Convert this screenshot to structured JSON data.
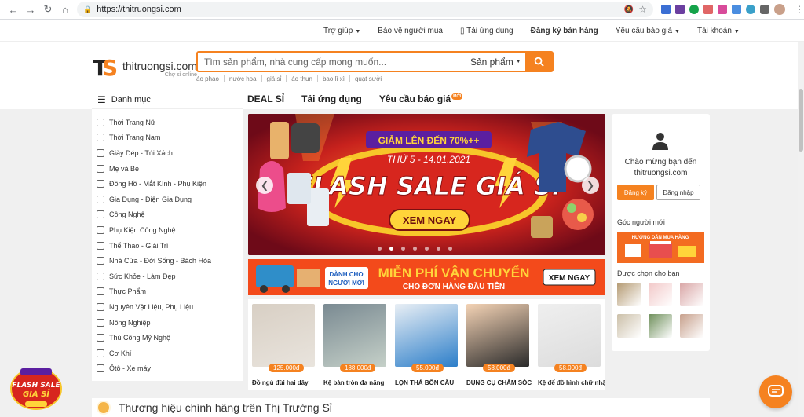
{
  "browser": {
    "url": "https://thitruongsi.com"
  },
  "topbar": {
    "items": [
      "Trợ giúp",
      "Bảo vệ người mua",
      "Tải ứng dụng",
      "Đăng ký bán hàng",
      "Yêu cầu báo giá",
      "Tài khoản"
    ]
  },
  "logo": {
    "name": "thitruongsi.com",
    "sub": "Chợ sỉ online"
  },
  "search": {
    "placeholder": "Tìm sản phẩm, nhà cung cấp mong muốn...",
    "category": "Sản phẩm",
    "hints": [
      "áo phao",
      "nước hoa",
      "giá sỉ",
      "áo thun",
      "bao lì xì",
      "quạt sưởi"
    ]
  },
  "sidebar": {
    "title": "Danh mục",
    "items": [
      "Thời Trang Nữ",
      "Thời Trang Nam",
      "Giày Dép - Túi Xách",
      "Mẹ và Bé",
      "Đồng Hồ - Mắt Kính - Phụ Kiện",
      "Gia Dụng - Điện Gia Dụng",
      "Công Nghệ",
      "Phụ Kiện Công Nghệ",
      "Thể Thao - Giải Trí",
      "Nhà Cửa - Đời Sống - Bách Hóa",
      "Sức Khỏe - Làm Đẹp",
      "Thực Phẩm",
      "Nguyên Vật Liệu, Phụ Liệu",
      "Nông Nghiệp",
      "Thủ Công Mỹ Nghệ",
      "Cơ Khí",
      "Ôtô - Xe máy"
    ]
  },
  "tabs": {
    "deal": "DEAL SỈ",
    "app": "Tải ứng dụng",
    "quote": "Yêu cầu báo giá",
    "badge": "MỚI"
  },
  "banner": {
    "discount": "GIẢM LÊN ĐẾN 70%++",
    "date": "THỨ 5 - 14.01.2021",
    "title": "FLASH SALE GIÁ SỈ",
    "cta": "XEM NGAY",
    "dot_count": 7,
    "active_dot": 1
  },
  "ship_banner": {
    "tag_line1": "DÀNH CHO",
    "tag_line2": "NGƯỜI MỚI",
    "title": "MIỄN PHÍ VẬN CHUYỂN",
    "subtitle": "CHO ĐƠN HÀNG ĐẦU TIÊN",
    "cta": "XEM NGAY"
  },
  "products": [
    {
      "price": "125.000đ",
      "name": "Đồ ngủ đùi hai dây",
      "colors": [
        "#d8cfc4",
        "#e9e4dd"
      ]
    },
    {
      "price": "188.000đ",
      "name": "Kệ bàn tròn đa năng",
      "colors": [
        "#7a8a92",
        "#c5d0c8"
      ]
    },
    {
      "price": "55.000đ",
      "name": "LỌN THẢ BỒN CẦU",
      "colors": [
        "#e9eff5",
        "#2c7ec9"
      ]
    },
    {
      "price": "58.000đ",
      "name": "DỤNG CỤ CHĂM SÓC",
      "colors": [
        "#f4d3b5",
        "#2a2a2a"
      ]
    },
    {
      "price": "58.000đ",
      "name": "Kệ để đồ hình chữ nhật",
      "colors": [
        "#efefef",
        "#dcdcdc"
      ]
    }
  ],
  "right_panel": {
    "welcome_line1": "Chào mừng bạn đến",
    "welcome_line2": "thitruongsi.com",
    "register": "Đăng ký",
    "login": "Đăng nhập",
    "newcomer_title": "Góc người mới",
    "guide_banner": "HƯỚNG DẪN MUA HÀNG",
    "picked_title": "Được chọn cho bạn",
    "thumb_colors": [
      "#b49a72",
      "#f2c8c8",
      "#d9a6a6",
      "#cbbfa8",
      "#6e8f5a",
      "#c7a08c"
    ]
  },
  "floating": {
    "flash_line1": "FLASH SALE",
    "flash_line2": "GIÁ SỈ"
  },
  "brand_section": {
    "title": "Thương hiệu chính hãng trên Thị Trường Sỉ"
  },
  "colors": {
    "accent": "#f58220",
    "banner_bg": "#8b0f1f",
    "ship_bg": "#f34a1b"
  }
}
